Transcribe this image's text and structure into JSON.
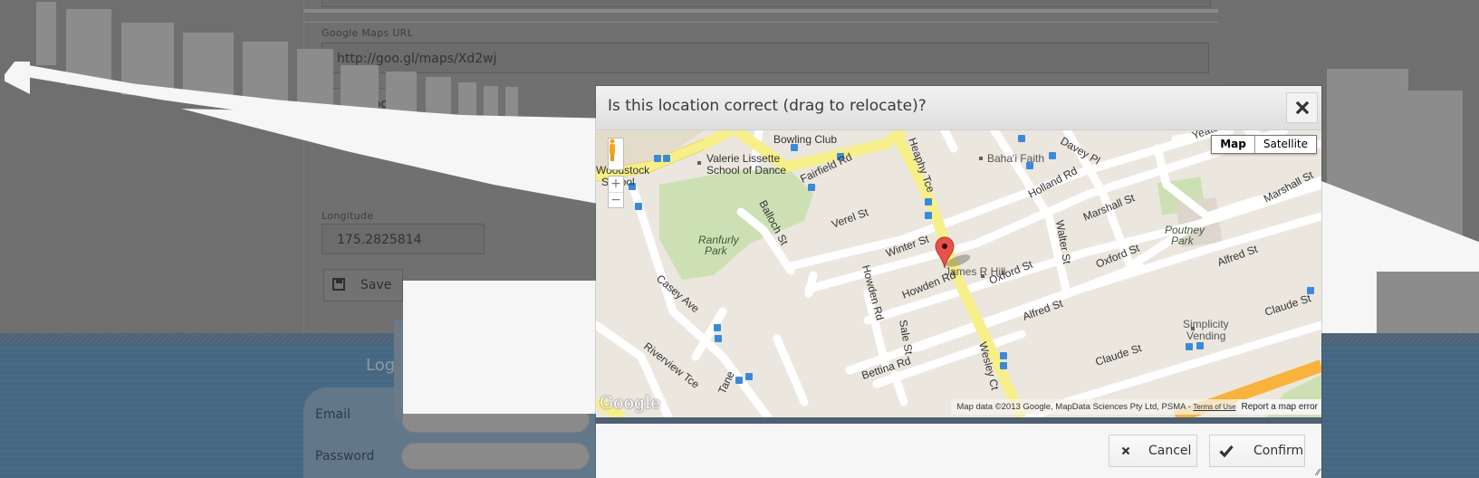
{
  "background_page": {
    "form": {
      "maps_url_label": "Google Maps URL",
      "maps_url_value": "http://goo.gl/maps/Xd2wj",
      "geocode_button": "Geocode",
      "longitude_label": "Longitude",
      "longitude_value": "175.2825814",
      "save_button": "Save"
    },
    "login": {
      "title": "Login",
      "email_label": "Email",
      "password_label": "Password"
    }
  },
  "modal": {
    "title": "Is this location correct (drag to relocate)?",
    "close_icon": "close-x-icon",
    "map": {
      "map_type": {
        "options": [
          "Map",
          "Satellite"
        ],
        "selected": "Map"
      },
      "zoom_in": "+",
      "zoom_out": "−",
      "logo": "Google",
      "attribution": "Map data ©2013 Google, MapData Sciences Pty Ltd, PSMA -",
      "terms_link": "Terms of Use",
      "report_link": "Report a map error",
      "marker_label": "James R Hill",
      "streets": [
        "Fairfield Rd",
        "Heaphy Tce",
        "Holland Rd",
        "Davey Pl",
        "Yeats",
        "Marshall St",
        "Verel St",
        "Balloch St",
        "Winter St",
        "Oxford St",
        "Howden Rd",
        "Walter St",
        "Alfred St",
        "Claude St",
        "Sale St",
        "Wesley Ct",
        "Bettina Rd",
        "Casey Ave",
        "Riverview Tce",
        "Tane"
      ],
      "places": [
        "Bowling Club",
        "Valerie Lissette School of Dance",
        "Woodstock School",
        "Baha'i Faith",
        "Ranfurly Park",
        "Poutney Park",
        "Simplicity Vending"
      ]
    },
    "buttons": {
      "cancel": "Cancel",
      "confirm": "Confirm"
    }
  }
}
